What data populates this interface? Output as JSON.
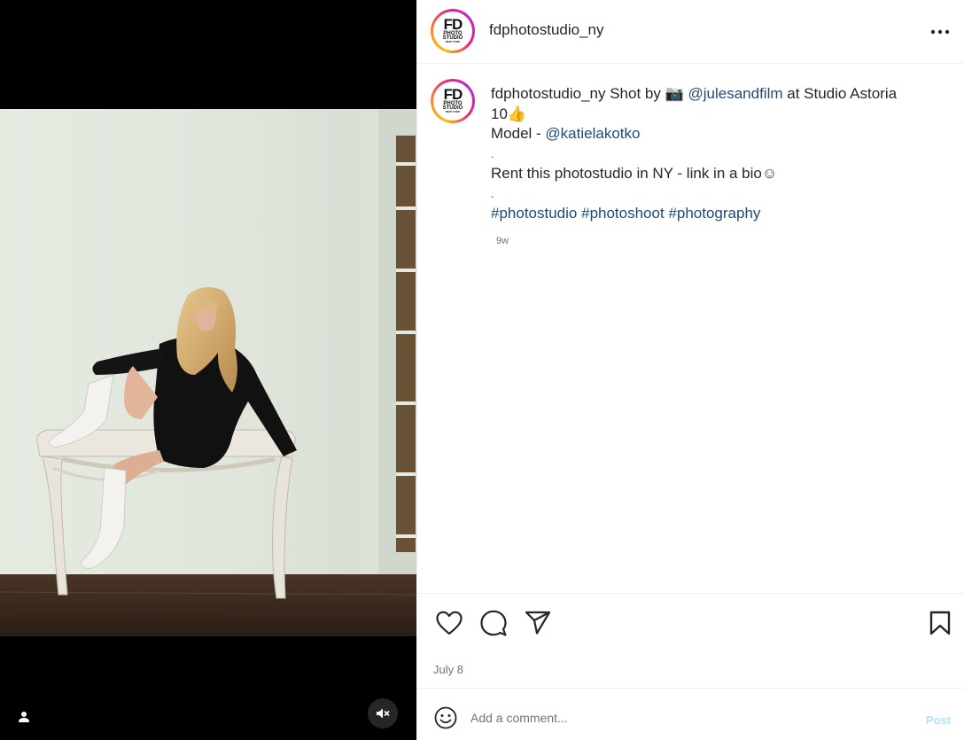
{
  "post": {
    "username": "fdphotostudio_ny",
    "avatar_logo": {
      "main": "FD",
      "line2": "PHOTO",
      "line3": "STUDIO",
      "line4": "NEW YORK"
    },
    "caption": {
      "username": "fdphotostudio_ny",
      "line1_text": " Shot by 📷  ",
      "photographer": "@julesandfilm",
      "line1_tail": " at Studio Astoria",
      "line2": "10👍",
      "model_label": "Model - ",
      "model": "@katielakotko",
      "dot1": ".",
      "rent_text": "Rent this photostudio in NY - link in a bio☺",
      "dot2": ".",
      "hashtags": [
        "#photostudio",
        "#photoshoot",
        "#photography"
      ]
    },
    "time_ago": "9w",
    "date": "July 8"
  },
  "comment_box": {
    "placeholder": "Add a comment...",
    "post_label": "Post"
  },
  "colors": {
    "link": "#1e4a7a",
    "post_button_disabled": "#b2dffc",
    "border": "#efefef",
    "media_bg": "#000000"
  },
  "icons": [
    "user-tag-icon",
    "mute-icon",
    "more-icon",
    "heart-icon",
    "comment-icon",
    "share-icon",
    "bookmark-icon",
    "emoji-icon"
  ]
}
